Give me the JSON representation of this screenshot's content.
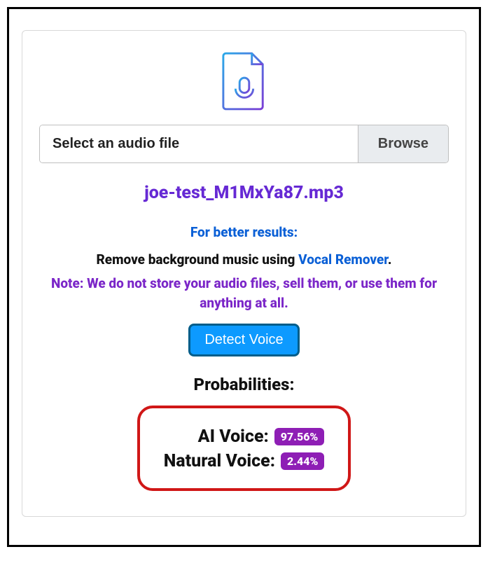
{
  "fileInput": {
    "placeholder": "Select an audio file",
    "browseLabel": "Browse"
  },
  "filename": "joe-test_M1MxYa87.mp3",
  "hints": {
    "title": "For better results:",
    "line1a": "Remove background music using ",
    "line1b": "Vocal Remover",
    "line1c": ".",
    "note": "Note: We do not store your audio files, sell them, or use them for anything at all."
  },
  "detectLabel": "Detect Voice",
  "probabilities": {
    "title": "Probabilities:",
    "aiLabel": "AI Voice:",
    "aiValue": "97.56%",
    "naturalLabel": "Natural Voice:",
    "naturalValue": "2.44%"
  }
}
